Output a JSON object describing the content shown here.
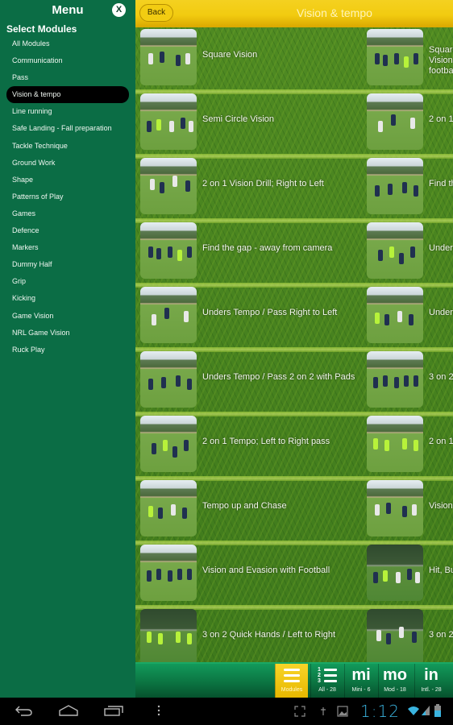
{
  "menu": {
    "title": "Menu",
    "close_label": "X",
    "section_title": "Select Modules",
    "items": [
      {
        "label": "All Modules",
        "active": false
      },
      {
        "label": "Communication",
        "active": false
      },
      {
        "label": "Pass",
        "active": false
      },
      {
        "label": "Vision & tempo",
        "active": true
      },
      {
        "label": "Line running",
        "active": false
      },
      {
        "label": "Safe Landing - Fall preparation",
        "active": false
      },
      {
        "label": "Tackle Technique",
        "active": false
      },
      {
        "label": "Ground Work",
        "active": false
      },
      {
        "label": "Shape",
        "active": false
      },
      {
        "label": "Patterns of Play",
        "active": false
      },
      {
        "label": "Games",
        "active": false
      },
      {
        "label": "Defence",
        "active": false
      },
      {
        "label": "Markers",
        "active": false
      },
      {
        "label": "Dummy Half",
        "active": false
      },
      {
        "label": "Grip",
        "active": false
      },
      {
        "label": "Kicking",
        "active": false
      },
      {
        "label": "Game Vision",
        "active": false
      },
      {
        "label": "NRL Game Vision",
        "active": false
      },
      {
        "label": "Ruck Play",
        "active": false
      }
    ]
  },
  "header": {
    "back_label": "Back",
    "title": "Vision & tempo"
  },
  "drills": [
    {
      "left": "Square Vision",
      "right": "Square Vision with football"
    },
    {
      "left": "Semi Circle Vision",
      "right": "2 on 1"
    },
    {
      "left": "2 on 1 Vision Drill; Right to Left",
      "right": "Find the"
    },
    {
      "left": "Find the gap - away from camera",
      "right": "Unders"
    },
    {
      "left": "Unders Tempo / Pass Right to Left",
      "right": "Unders"
    },
    {
      "left": "Unders Tempo / Pass 2 on 2 with Pads",
      "right": "3 on 2"
    },
    {
      "left": "2 on 1 Tempo;  Left to Right pass",
      "right": "2 on 1"
    },
    {
      "left": "Tempo up and Chase",
      "right": "Vision"
    },
    {
      "left": "Vision and Evasion with Football",
      "right": "Hit, Bu"
    },
    {
      "left": "3 on 2 Quick Hands / Left to Right",
      "right": "3 on 2"
    }
  ],
  "tabs": [
    {
      "id": "modules",
      "icon": "hamburger-icon",
      "big": "",
      "small": "Modules",
      "active": true
    },
    {
      "id": "all",
      "icon": "numbered-list-icon",
      "big": "",
      "small": "All - 28",
      "active": false
    },
    {
      "id": "mini",
      "icon": "",
      "big": "mi",
      "small": "Mini - 6",
      "active": false
    },
    {
      "id": "mod",
      "icon": "",
      "big": "mo",
      "small": "Mod - 18",
      "active": false
    },
    {
      "id": "intl",
      "icon": "",
      "big": "in",
      "small": "Intl. - 28",
      "active": false
    }
  ],
  "system": {
    "clock": "1:12",
    "accent": "#3ab4e0"
  },
  "colors": {
    "sidebar": "#0b6d45",
    "header": "#f2cb10",
    "tabbar": "#0c7844"
  }
}
